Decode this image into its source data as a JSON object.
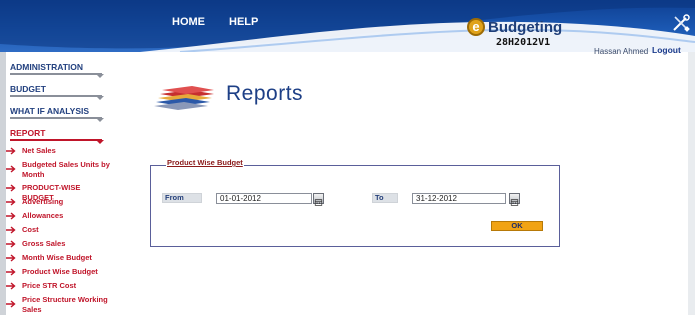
{
  "header": {
    "nav": [
      {
        "label": "HOME"
      },
      {
        "label": "HELP"
      }
    ],
    "logo": {
      "letter": "e",
      "text": "Budgeting"
    },
    "version": "28H2012V1",
    "user_name": "Hassan Ahmed",
    "logout_label": "Logout"
  },
  "sidebar": {
    "sections": [
      {
        "label": "ADMINISTRATION"
      },
      {
        "label": "BUDGET"
      },
      {
        "label": "WHAT IF ANALYSIS"
      },
      {
        "label": "REPORT"
      }
    ],
    "menu": [
      {
        "label": "Net Sales"
      },
      {
        "label": "Budgeted Sales Units by Month"
      },
      {
        "label": "PRODUCT-WISE BUDGET"
      },
      {
        "label": "Advertising"
      },
      {
        "label": "Allowances"
      },
      {
        "label": "Cost"
      },
      {
        "label": "Gross Sales"
      },
      {
        "label": "Month Wise Budget"
      },
      {
        "label": "Product Wise Budget"
      },
      {
        "label": "Price STR Cost"
      },
      {
        "label": "Price Structure Working Sales"
      }
    ]
  },
  "main": {
    "title": "Reports",
    "form": {
      "legend": "Product Wise Budget",
      "from_label": "From",
      "from_value": "01-01-2012",
      "to_label": "To",
      "to_value": "31-12-2012",
      "ok_label": "OK"
    }
  },
  "colors": {
    "header_blue": "#1b58b2",
    "menu_red": "#c0152a",
    "section_blue": "#22407f",
    "ok_orange": "#f1a314"
  },
  "icons": {
    "logo": "e-circle-logo",
    "tools": "tools-icon",
    "menu_arrow": "arrow-right-icon",
    "calendar": "calendar-icon",
    "reports": "stacked-layers-icon"
  }
}
